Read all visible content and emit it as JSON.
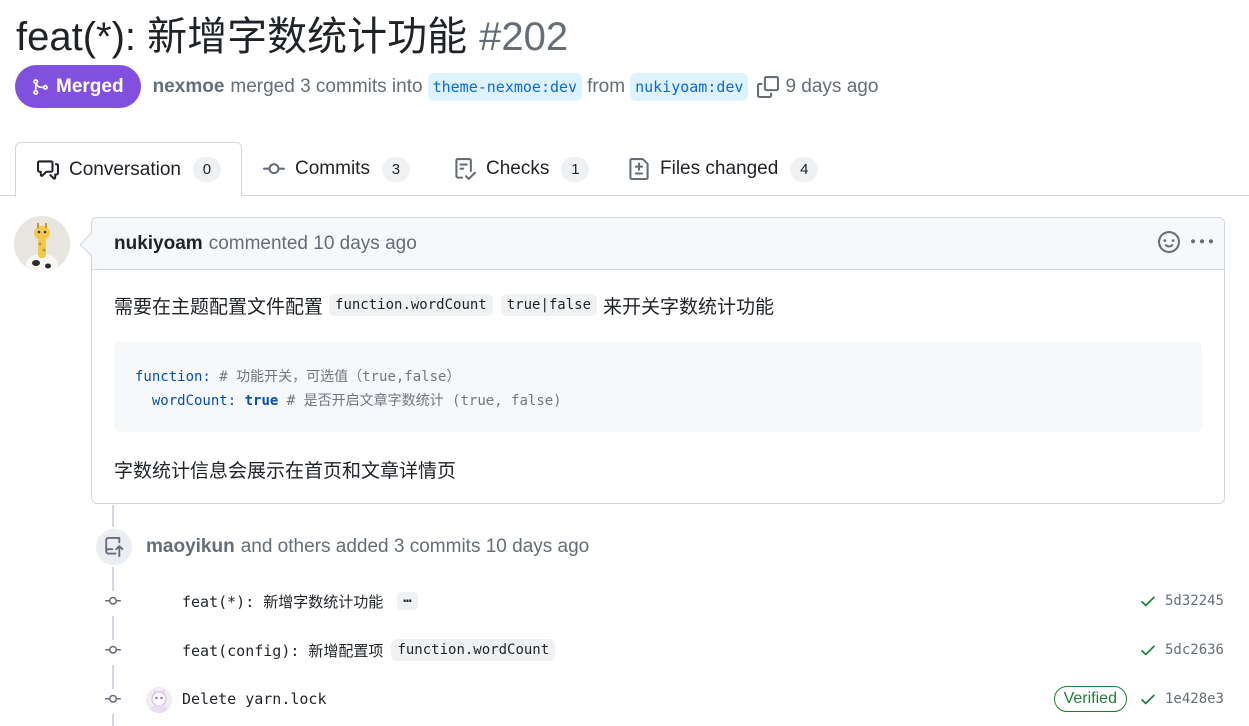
{
  "header": {
    "title": "feat(*): 新增字数统计功能",
    "number": "#202",
    "state_label": "Merged",
    "merger": "nexmoe",
    "merge_text": "merged 3 commits into",
    "base_branch": "theme-nexmoe:dev",
    "from_text": "from",
    "head_branch": "nukiyoam:dev",
    "time_ago": "9 days ago"
  },
  "tabs": [
    {
      "label": "Conversation",
      "count": "0",
      "icon": "comment-discussion-icon"
    },
    {
      "label": "Commits",
      "count": "3",
      "icon": "git-commit-icon"
    },
    {
      "label": "Checks",
      "count": "1",
      "icon": "checklist-icon"
    },
    {
      "label": "Files changed",
      "count": "4",
      "icon": "file-diff-icon"
    }
  ],
  "comment": {
    "author": "nukiyoam",
    "action_text": "commented 10 days ago",
    "line1_prefix": "需要在主题配置文件配置",
    "code1": "function.wordCount",
    "code2": "true|false",
    "line1_suffix": "来开关字数统计功能",
    "code_block": {
      "l1_key": "function:",
      "l1_comment": "# 功能开关，可选值（true,false）",
      "l2_key": "wordCount:",
      "l2_value": "true",
      "l2_comment": "# 是否开启文章字数统计 (true, false)"
    },
    "line3": "字数统计信息会展示在首页和文章详情页"
  },
  "timeline": {
    "actor": "maoyikun",
    "event_text": "and others added 3 commits 10 days ago",
    "commits": [
      {
        "message": "feat(*): 新增字数统计功能",
        "has_more": "…",
        "sha": "5d32245"
      },
      {
        "message": "feat(config): 新增配置项",
        "code": "function.wordCount",
        "sha": "5dc2636"
      },
      {
        "message": "Delete yarn.lock",
        "verified": "Verified",
        "sha": "1e428e3"
      }
    ]
  },
  "colors": {
    "merged": "#8250df",
    "branch_bg": "#ddf4ff",
    "branch_fg": "#0969da",
    "success": "#1a7f37"
  }
}
